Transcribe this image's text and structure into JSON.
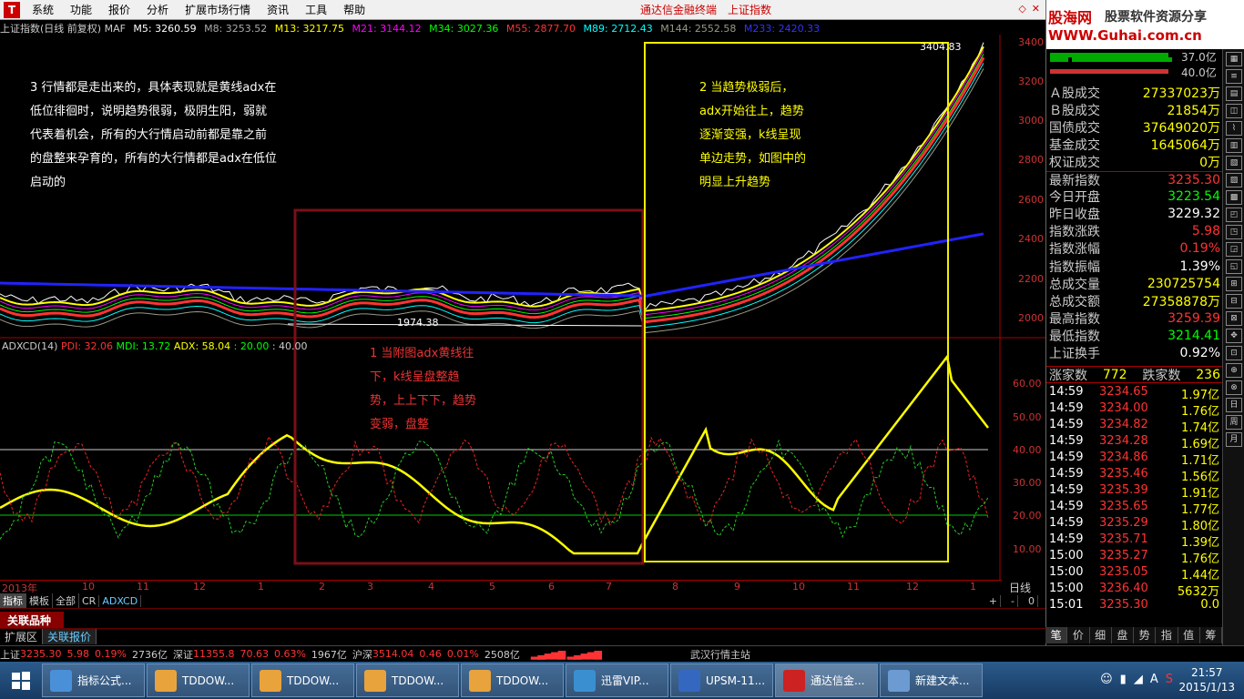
{
  "menu": {
    "items": [
      "系统",
      "功能",
      "报价",
      "分析",
      "扩展市场行情",
      "资讯",
      "工具",
      "帮助"
    ],
    "center_links": [
      "通达信金融终端",
      "上证指数"
    ]
  },
  "brand": {
    "line1": "股海网",
    "line2": "股票软件资源分享",
    "line3": "WWW.Guhai.com.cn"
  },
  "chart_header": {
    "title": "上证指数(日线 前复权) MAF",
    "mas": [
      {
        "label": "M5: 3260.59",
        "color": "#ffffff"
      },
      {
        "label": "M8: 3253.52",
        "color": "#aaaaaa"
      },
      {
        "label": "M13: 3217.75",
        "color": "#ffff00"
      },
      {
        "label": "M21: 3144.12",
        "color": "#ff00ff"
      },
      {
        "label": "M34: 3027.36",
        "color": "#00ff00"
      },
      {
        "label": "M55: 2877.70",
        "color": "#ff3333"
      },
      {
        "label": "M89: 2712.43",
        "color": "#00ffff"
      },
      {
        "label": "M144: 2552.58",
        "color": "#888844"
      },
      {
        "label": "M233: 2420.33",
        "color": "#3333ff"
      }
    ]
  },
  "indicator_header": {
    "name": "ADXCD(14)",
    "pdi": "PDI: 32.06",
    "mdi": "MDI: 13.72",
    "adx": "ADX: 58.04",
    "l1": ": 20.00",
    "l2": ": 40.00"
  },
  "annotations": {
    "a3": [
      "3 行情都是走出来的，具体表现就是黄线adx在",
      "低位徘徊时，说明趋势很弱，极阴生阳，弱就",
      "代表着机会，所有的大行情启动前都是靠之前",
      "的盘整来孕育的，所有的大行情都是adx在低位",
      "启动的"
    ],
    "a2": [
      "2 当趋势极弱后，",
      "adx开始往上，趋势",
      "逐渐变强，k线呈现",
      "单边走势，如图中的",
      "明显上升趋势"
    ],
    "a1": [
      "1 当附图adx黄线往",
      "下，k线呈盘整趋",
      "势，上上下下，趋势",
      "变弱，盘整"
    ],
    "high_label": "3404.83",
    "low_label": "1974.38"
  },
  "price_axis": [
    "3400",
    "3200",
    "3000",
    "2800",
    "2600",
    "2400",
    "2200",
    "2000"
  ],
  "ind_axis": [
    "60.00",
    "50.00",
    "40.00",
    "30.00",
    "20.00",
    "10.00"
  ],
  "time_axis": {
    "labels": [
      "2013年",
      "10",
      "11",
      "12",
      "1",
      "2",
      "3",
      "4",
      "5",
      "6",
      "7",
      "8",
      "9",
      "10",
      "11",
      "12",
      "1"
    ],
    "period": "日线"
  },
  "tabs": {
    "items": [
      "指标",
      "模板",
      "全部",
      "CR",
      "ADXCD"
    ],
    "right": [
      "+",
      "-",
      "0"
    ]
  },
  "related": {
    "title": "关联品种",
    "sub": [
      "扩展区",
      "关联报价"
    ]
  },
  "panel": {
    "bars": [
      {
        "value": "37.0亿"
      },
      {
        "value": "40.0亿"
      }
    ],
    "rows": [
      {
        "label": "Ａ股成交",
        "value": "27337023万",
        "color": "yellow"
      },
      {
        "label": "Ｂ股成交",
        "value": "21854万",
        "color": "yellow"
      },
      {
        "label": "国债成交",
        "value": "37649020万",
        "color": "yellow"
      },
      {
        "label": "基金成交",
        "value": "1645064万",
        "color": "yellow"
      },
      {
        "label": "权证成交",
        "value": "0万",
        "color": "yellow"
      },
      {
        "label": "最新指数",
        "value": "3235.30",
        "color": "red"
      },
      {
        "label": "今日开盘",
        "value": "3223.54",
        "color": "green"
      },
      {
        "label": "昨日收盘",
        "value": "3229.32",
        "color": "white"
      },
      {
        "label": "指数涨跌",
        "value": "5.98",
        "color": "red"
      },
      {
        "label": "指数涨幅",
        "value": "0.19%",
        "color": "red"
      },
      {
        "label": "指数振幅",
        "value": "1.39%",
        "color": "white"
      },
      {
        "label": "总成交量",
        "value": "230725754",
        "color": "yellow"
      },
      {
        "label": "总成交额",
        "value": "27358878万",
        "color": "yellow"
      },
      {
        "label": "最高指数",
        "value": "3259.39",
        "color": "red"
      },
      {
        "label": "最低指数",
        "value": "3214.41",
        "color": "green"
      },
      {
        "label": "上证换手",
        "value": "0.92%",
        "color": "white"
      }
    ],
    "updown": {
      "up_label": "涨家数",
      "up": "772",
      "down_label": "跌家数",
      "down": "236"
    },
    "ticks": [
      {
        "t": "14:59",
        "p": "3234.65",
        "v": "1.97亿"
      },
      {
        "t": "14:59",
        "p": "3234.00",
        "v": "1.76亿"
      },
      {
        "t": "14:59",
        "p": "3234.82",
        "v": "1.74亿"
      },
      {
        "t": "14:59",
        "p": "3234.28",
        "v": "1.69亿"
      },
      {
        "t": "14:59",
        "p": "3234.86",
        "v": "1.71亿"
      },
      {
        "t": "14:59",
        "p": "3235.46",
        "v": "1.56亿"
      },
      {
        "t": "14:59",
        "p": "3235.39",
        "v": "1.91亿"
      },
      {
        "t": "14:59",
        "p": "3235.65",
        "v": "1.77亿"
      },
      {
        "t": "14:59",
        "p": "3235.29",
        "v": "1.80亿"
      },
      {
        "t": "14:59",
        "p": "3235.71",
        "v": "1.39亿"
      },
      {
        "t": "15:00",
        "p": "3235.27",
        "v": "1.76亿"
      },
      {
        "t": "15:00",
        "p": "3235.05",
        "v": "1.44亿"
      },
      {
        "t": "15:00",
        "p": "3236.40",
        "v": "5632万"
      },
      {
        "t": "15:01",
        "p": "3235.30",
        "v": "0.0"
      }
    ],
    "tabs": [
      "笔",
      "价",
      "细",
      "盘",
      "势",
      "指",
      "值",
      "筹"
    ]
  },
  "right_tools": [
    "日",
    "周",
    "月"
  ],
  "ticker": {
    "sh_label": "上证",
    "sh": "3235.30",
    "sh_chg": "5.98",
    "sh_pct": "0.19%",
    "sh_amt": "2736亿",
    "sz_label": "深证",
    "sz": "11355.8",
    "sz_chg": "70.63",
    "sz_pct": "0.63%",
    "sz_amt": "1967亿",
    "hs_label": "沪深",
    "hs": "3514.04",
    "hs_chg": "0.46",
    "hs_pct": "0.01%",
    "hs_amt": "2508亿",
    "station": "武汉行情主站"
  },
  "taskbar": {
    "tasks": [
      {
        "label": "指标公式...",
        "color": "#4a90d9"
      },
      {
        "label": "TDDOW...",
        "color": "#e8a33d"
      },
      {
        "label": "TDDOW...",
        "color": "#e8a33d"
      },
      {
        "label": "TDDOW...",
        "color": "#e8a33d"
      },
      {
        "label": "TDDOW...",
        "color": "#e8a33d"
      },
      {
        "label": "迅雷VIP...",
        "color": "#3a8fd0"
      },
      {
        "label": "UPSM-11...",
        "color": "#3468c0"
      },
      {
        "label": "通达信金...",
        "color": "#cc2222"
      },
      {
        "label": "新建文本...",
        "color": "#6c9bd2"
      }
    ],
    "time": "21:57",
    "date": "2015/1/13"
  }
}
